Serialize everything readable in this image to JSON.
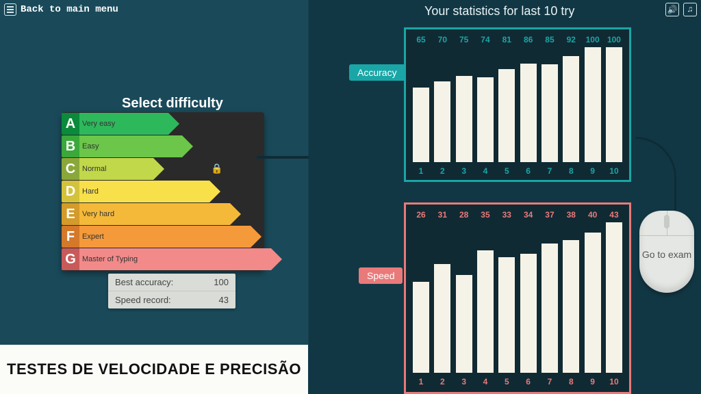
{
  "topbar": {
    "back_label": "Back to main menu"
  },
  "stats_title": "Your statistics for last 10 try",
  "difficulty": {
    "title": "Select difficulty",
    "rows": [
      {
        "letter": "A",
        "label": "Very easy"
      },
      {
        "letter": "B",
        "label": "Easy"
      },
      {
        "letter": "C",
        "label": "Normal",
        "locked": true
      },
      {
        "letter": "D",
        "label": "Hard"
      },
      {
        "letter": "E",
        "label": "Very hard"
      },
      {
        "letter": "F",
        "label": "Expert"
      },
      {
        "letter": "G",
        "label": "Master of Typing"
      }
    ]
  },
  "records": {
    "best_accuracy_label": "Best accuracy:",
    "best_accuracy_value": "100",
    "speed_record_label": "Speed record:",
    "speed_record_value": "43"
  },
  "banner": "TESTES DE VELOCIDADE E PRECISÃO",
  "labels": {
    "accuracy": "Accuracy",
    "speed": "Speed"
  },
  "exam_button": "Go to exam",
  "chart_data": [
    {
      "type": "bar",
      "name": "accuracy",
      "title": "Accuracy",
      "categories": [
        "1",
        "2",
        "3",
        "4",
        "5",
        "6",
        "7",
        "8",
        "9",
        "10"
      ],
      "values": [
        65,
        70,
        75,
        74,
        81,
        86,
        85,
        92,
        100,
        100
      ],
      "ylim": [
        0,
        100
      ]
    },
    {
      "type": "bar",
      "name": "speed",
      "title": "Speed",
      "categories": [
        "1",
        "2",
        "3",
        "4",
        "5",
        "6",
        "7",
        "8",
        "9",
        "10"
      ],
      "values": [
        26,
        31,
        28,
        35,
        33,
        34,
        37,
        38,
        40,
        43
      ],
      "ylim": [
        0,
        43
      ]
    }
  ]
}
